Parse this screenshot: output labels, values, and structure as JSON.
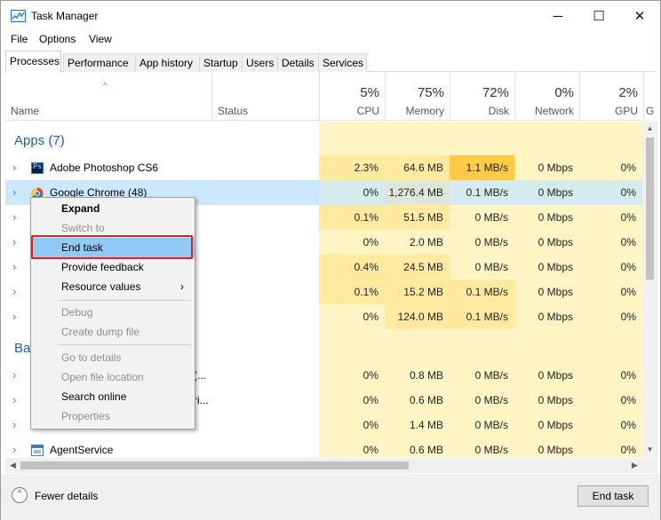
{
  "window": {
    "title": "Task Manager",
    "minimize": "─",
    "maximize": "☐",
    "close": "✕"
  },
  "menu": [
    "File",
    "Options",
    "View"
  ],
  "tabs": [
    "Processes",
    "Performance",
    "App history",
    "Startup",
    "Users",
    "Details",
    "Services"
  ],
  "active_tab": "Processes",
  "columns": {
    "name": "Name",
    "status": "Status",
    "cpu": {
      "pct": "5%",
      "label": "CPU"
    },
    "memory": {
      "pct": "75%",
      "label": "Memory"
    },
    "disk": {
      "pct": "72%",
      "label": "Disk"
    },
    "network": {
      "pct": "0%",
      "label": "Network"
    },
    "gpu": {
      "pct": "2%",
      "label": "GPU"
    },
    "gpu_engine_partial": "G"
  },
  "groups": {
    "apps": "Apps (7)",
    "background_partial": "Ba"
  },
  "rows": [
    {
      "name": "Adobe Photoshop CS6",
      "icon": "photoshop-icon",
      "cpu": "2.3%",
      "mem": "64.6 MB",
      "disk": "1.1 MB/s",
      "net": "0 Mbps",
      "gpu": "0%"
    },
    {
      "name": "Google Chrome (48)",
      "icon": "chrome-icon",
      "cpu": "0%",
      "mem": "1,276.4 MB",
      "disk": "0.1 MB/s",
      "net": "0 Mbps",
      "gpu": "0%"
    },
    {
      "name": "",
      "cpu": "0.1%",
      "mem": "51.5 MB",
      "disk": "0 MB/s",
      "net": "0 Mbps",
      "gpu": "0%"
    },
    {
      "name": "",
      "cpu": "0%",
      "mem": "2.0 MB",
      "disk": "0 MB/s",
      "net": "0 Mbps",
      "gpu": "0%"
    },
    {
      "name": "",
      "cpu": "0.4%",
      "mem": "24.5 MB",
      "disk": "0 MB/s",
      "net": "0 Mbps",
      "gpu": "0%"
    },
    {
      "name": "",
      "cpu": "0.1%",
      "mem": "15.2 MB",
      "disk": "0.1 MB/s",
      "net": "0 Mbps",
      "gpu": "0%"
    },
    {
      "name": "",
      "cpu": "0%",
      "mem": "124.0 MB",
      "disk": "0.1 MB/s",
      "net": "0 Mbps",
      "gpu": "0%"
    },
    {
      "name": "(...",
      "cpu": "0%",
      "mem": "0.8 MB",
      "disk": "0 MB/s",
      "net": "0 Mbps",
      "gpu": "0%"
    },
    {
      "name": "ri...",
      "cpu": "0%",
      "mem": "0.6 MB",
      "disk": "0 MB/s",
      "net": "0 Mbps",
      "gpu": "0%"
    },
    {
      "name": "",
      "cpu": "0%",
      "mem": "1.4 MB",
      "disk": "0 MB/s",
      "net": "0 Mbps",
      "gpu": "0%"
    },
    {
      "name": "AgentService",
      "icon": "service-icon",
      "cpu": "0%",
      "mem": "0.6 MB",
      "disk": "0 MB/s",
      "net": "0 Mbps",
      "gpu": "0%"
    }
  ],
  "context_menu": {
    "expand": "Expand",
    "switch_to": "Switch to",
    "end_task": "End task",
    "provide_feedback": "Provide feedback",
    "resource_values": "Resource values",
    "submenu_arrow": "›",
    "debug": "Debug",
    "create_dump": "Create dump file",
    "go_to_details": "Go to details",
    "open_file_location": "Open file location",
    "search_online": "Search online",
    "properties": "Properties"
  },
  "footer": {
    "fewer_details": "Fewer details",
    "end_task": "End task"
  },
  "colors": {
    "heat_light": "#fff4c4",
    "heat_mid": "#ffeaa0",
    "heat_high": "#ffcb47",
    "selection": "#cce8ff",
    "group": "#1f5fa8",
    "highlight_box": "#e02020"
  }
}
